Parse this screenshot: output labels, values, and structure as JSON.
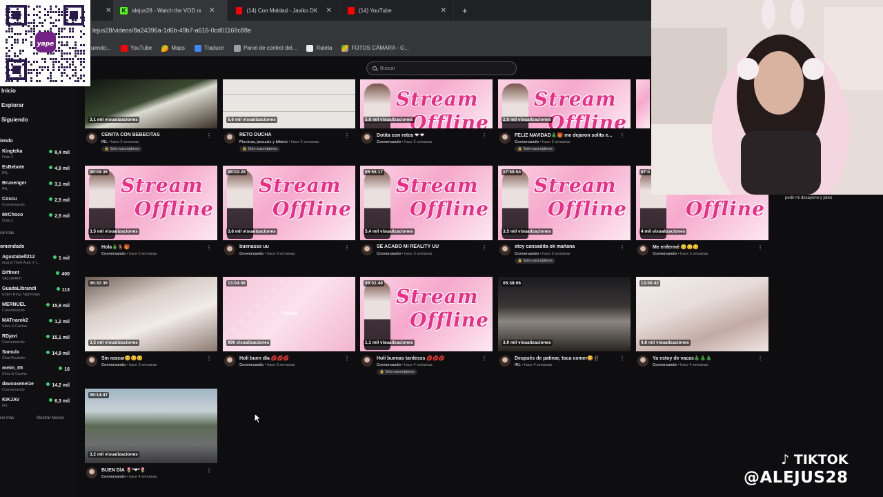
{
  "tabs": [
    {
      "label": "",
      "favicon": "tab-icon"
    },
    {
      "label": "alejus28 - Watch the VOD on K",
      "favicon": "K"
    },
    {
      "label": "(14) Con Maldad - Javiko DK",
      "favicon": "youtube-icon"
    },
    {
      "label": "(14) YouTube",
      "favicon": "youtube-icon"
    }
  ],
  "new_tab": "+",
  "address": "lejus28/videos/8a24396a-1d6b-49b7-a616-0cd01169c88e",
  "bookmarks": [
    "uendo...",
    "YouTube",
    "Maps",
    "Traducir",
    "Panel de control del...",
    "Ruleta",
    "FOTOS CÁMARA - G..."
  ],
  "qr": {
    "brand": "yape"
  },
  "search_placeholder": "Buscar",
  "nav": {
    "home": "Inicio",
    "explore": "Explorar",
    "following": "Siguiendo"
  },
  "following_title": "iendo",
  "following": [
    {
      "name": "Kingteka",
      "game": "Dota 2",
      "viewers": "8,4 mil"
    },
    {
      "name": "EsBebote",
      "game": "IRL",
      "viewers": "4,9 mil"
    },
    {
      "name": "Brunenger",
      "game": "IRL",
      "viewers": "3,1 mil"
    },
    {
      "name": "Coscu",
      "game": "Conversando",
      "viewers": "2,5 mil"
    },
    {
      "name": "MrChoco",
      "game": "Dota 2",
      "viewers": "2,5 mil"
    }
  ],
  "show_more_following": "rar más",
  "recommended_title": "omendado",
  "recommended": [
    {
      "name": "Agustabell212",
      "game": "Grand Theft Auto V (...",
      "viewers": "1 mil"
    },
    {
      "name": "Diffrent",
      "game": "VALORANT",
      "viewers": "400"
    },
    {
      "name": "GuadaLibrandi",
      "game": "Elden Ring: Nightreign",
      "viewers": "113"
    },
    {
      "name": "MERNUEL",
      "game": "Conversando",
      "viewers": "15,9 mil"
    },
    {
      "name": "MATnarok2",
      "game": "Slots & Casino",
      "viewers": "1,2 mil"
    },
    {
      "name": "RDjavi",
      "game": "Conversando",
      "viewers": "15,1 mil"
    },
    {
      "name": "Samulx",
      "game": "Chat Roulette",
      "viewers": "14,9 mil"
    },
    {
      "name": "meim_05",
      "game": "Slots & Casino",
      "viewers": "16"
    },
    {
      "name": "davooxeneize",
      "game": "Conversando",
      "viewers": "14,2 mil"
    },
    {
      "name": "KIKJAV",
      "game": "IRL",
      "viewers": "6,3 mil"
    }
  ],
  "show_more_rec": "rar más",
  "show_less": "Mostrar Menos",
  "videos": [
    {
      "duration": "",
      "views": "3,1 mil visualizaciones",
      "title": "CENITA CON BEBECITAS",
      "category": "IRL",
      "ago": "hace 2 semanas",
      "tag": "Solo-suscriptores",
      "thumb": "dark"
    },
    {
      "duration": "",
      "views": "6,6 mil visualizaciones",
      "title": "RETO DUCHA",
      "category": "Piscinas, jacuzzis y bikinis",
      "ago": "hace 2 semanas",
      "tag": "Solo-suscriptores",
      "thumb": "tiles"
    },
    {
      "duration": "",
      "views": "5,6 mil visualizaciones",
      "title": "Dotita con retos ❤ ❤",
      "category": "Conversando",
      "ago": "hace 2 semanas",
      "tag": "",
      "thumb": "offline"
    },
    {
      "duration": "",
      "views": "2,6 mil visualizaciones",
      "title": "FELIZ NAVIDAD🎄🎁 me dejaron solita e...",
      "category": "Conversando",
      "ago": "hace 2 semanas",
      "tag": "Solo-suscriptores",
      "thumb": "offline"
    },
    {
      "duration": "09:09:36",
      "views": "3,5 mil visualizaciones",
      "title": "Hola🎄🦌🎁",
      "category": "Conversando",
      "ago": "hace 2 semanas",
      "tag": "",
      "thumb": "offline"
    },
    {
      "duration": "08:02:28",
      "views": "3,6 mil visualizaciones",
      "title": "buenasss uu",
      "category": "Conversando",
      "ago": "hace 3 semanas",
      "tag": "",
      "thumb": "offline"
    },
    {
      "duration": "05:55:17",
      "views": "5,4 mil visualizaciones",
      "title": "SE ACABÓ MI REALITY UU",
      "category": "Conversando",
      "ago": "hace 3 semanas",
      "tag": "",
      "thumb": "offline"
    },
    {
      "duration": "17:59:54",
      "views": "3,5 mil visualizaciones",
      "title": "etoy cansadita ok mañana",
      "category": "Conversando",
      "ago": "hace 3 semanas",
      "tag": "Solo-suscriptores",
      "thumb": "offline"
    },
    {
      "duration": "07:0",
      "views": "4 mil visualizaciones",
      "title": "Me enfermé 😔😔😔",
      "category": "Conversando",
      "ago": "hace 3 semanas",
      "tag": "",
      "thumb": "offline"
    },
    {
      "duration": "06:32:36",
      "views": "3,5 mil visualizaciones",
      "title": "Sin rascar😊😊😊",
      "category": "Conversando",
      "ago": "hace 3 semanas",
      "tag": "",
      "thumb": "room"
    },
    {
      "duration": "13:04:08",
      "views": "996 visualizaciones",
      "title": "Holi buen día 💋💋💋",
      "category": "Conversando",
      "ago": "hace 3 semanas",
      "tag": "",
      "thumb": "priv",
      "private": "Privado"
    },
    {
      "duration": "09:02:46",
      "views": "1,1 mil visualizaciones",
      "title": "Holi buenas tardesss 💋💋💋",
      "category": "Conversando",
      "ago": "hace 4 semanas",
      "tag": "Solo-suscriptores",
      "thumb": "offline"
    },
    {
      "duration": "05:38:06",
      "views": "3,9 mil visualizaciones",
      "title": "Después de patinar, toca comer😋🍴",
      "category": "IRL",
      "ago": "hace 4 semanas",
      "tag": "",
      "thumb": "car"
    },
    {
      "duration": "13:00:42",
      "views": "4,8 mil visualizaciones",
      "title": "Ya estoy de vacas🎄🎄🎄",
      "category": "Conversando",
      "ago": "hace 4 semanas",
      "tag": "",
      "thumb": "bed"
    },
    {
      "duration": "06:14:47",
      "views": "3,2 mil visualizaciones",
      "title": "BUEN DÍA 🌷*❤*🌷",
      "category": "Conversando",
      "ago": "hace 4 semanas",
      "tag": "",
      "thumb": "street"
    }
  ],
  "offline_text": {
    "line1": "Stream",
    "line2": "Offline"
  },
  "chat_line": "pedir mi desayuno y jateo",
  "watermark": {
    "line1": "TIKTOK",
    "line2": "@ALEJUS28"
  }
}
